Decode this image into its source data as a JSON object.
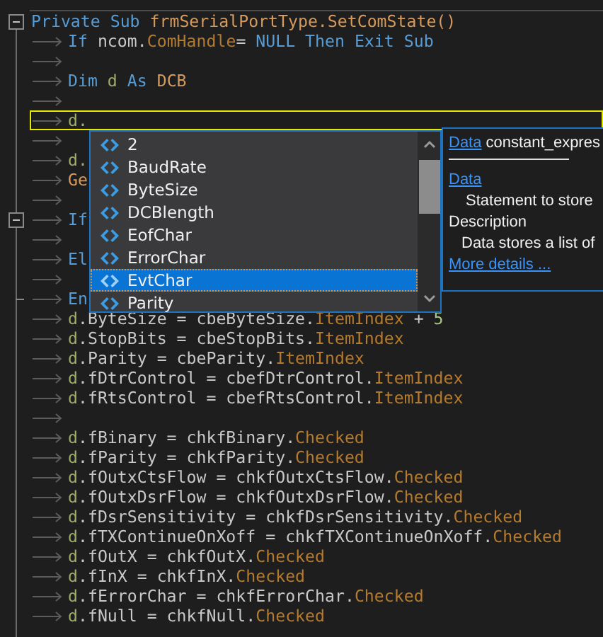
{
  "editor": {
    "lines": [
      {
        "kind": "foldstart",
        "indented": false,
        "current": false,
        "tokens": [
          {
            "text": "Private Sub ",
            "kind": "keyword"
          },
          {
            "text": "frmSerialPortType.SetComState()",
            "kind": "type"
          }
        ]
      },
      {
        "kind": "code",
        "indented": true,
        "current": false,
        "tokens": [
          {
            "text": "If ",
            "kind": "keyword"
          },
          {
            "text": "ncom.",
            "kind": "plain"
          },
          {
            "text": "ComHandle",
            "kind": "member"
          },
          {
            "text": "= ",
            "kind": "plain"
          },
          {
            "text": "NULL Then Exit Sub",
            "kind": "keyword"
          }
        ]
      },
      {
        "kind": "code",
        "indented": true,
        "current": false
      },
      {
        "kind": "code",
        "indented": true,
        "current": false,
        "tokens": [
          {
            "text": "Dim ",
            "kind": "keyword"
          },
          {
            "text": "d ",
            "kind": "variable"
          },
          {
            "text": "As ",
            "kind": "keyword"
          },
          {
            "text": "DCB",
            "kind": "type"
          }
        ]
      },
      {
        "kind": "code",
        "indented": true,
        "current": false
      },
      {
        "kind": "code",
        "indented": true,
        "current": true,
        "tokens": [
          {
            "text": "d.",
            "kind": "variable"
          }
        ]
      },
      {
        "kind": "code",
        "indented": true,
        "current": false
      },
      {
        "kind": "code",
        "indented": true,
        "current": false,
        "tokens": [
          {
            "text": "d.",
            "kind": "variable"
          }
        ]
      },
      {
        "kind": "code",
        "indented": true,
        "current": false,
        "tokens": [
          {
            "text": "Ge",
            "kind": "type"
          }
        ]
      },
      {
        "kind": "code",
        "indented": true,
        "current": false
      },
      {
        "kind": "foldstart",
        "indented": true,
        "current": false,
        "tokens": [
          {
            "text": "If",
            "kind": "keyword"
          }
        ]
      },
      {
        "kind": "code",
        "indented": true,
        "current": false
      },
      {
        "kind": "code",
        "indented": true,
        "current": false,
        "tokens": [
          {
            "text": "El",
            "kind": "keyword"
          }
        ]
      },
      {
        "kind": "code",
        "indented": true,
        "current": false
      },
      {
        "kind": "foldend",
        "indented": true,
        "current": false,
        "tokens": [
          {
            "text": "En",
            "kind": "keyword"
          }
        ]
      },
      {
        "kind": "code",
        "indented": true,
        "current": false,
        "tokens": [
          {
            "text": "d",
            "kind": "variable"
          },
          {
            "text": ".ByteSize = cbeByteSize.",
            "kind": "plain"
          },
          {
            "text": "ItemIndex",
            "kind": "member"
          },
          {
            "text": " + ",
            "kind": "plain"
          },
          {
            "text": "5",
            "kind": "number"
          }
        ]
      },
      {
        "kind": "code",
        "indented": true,
        "current": false,
        "tokens": [
          {
            "text": "d",
            "kind": "variable"
          },
          {
            "text": ".StopBits = cbeStopBits.",
            "kind": "plain"
          },
          {
            "text": "ItemIndex",
            "kind": "member"
          }
        ]
      },
      {
        "kind": "code",
        "indented": true,
        "current": false,
        "tokens": [
          {
            "text": "d",
            "kind": "variable"
          },
          {
            "text": ".Parity = cbeParity.",
            "kind": "plain"
          },
          {
            "text": "ItemIndex",
            "kind": "member"
          }
        ]
      },
      {
        "kind": "code",
        "indented": true,
        "current": false,
        "tokens": [
          {
            "text": "d",
            "kind": "variable"
          },
          {
            "text": ".fDtrControl = cbefDtrControl.",
            "kind": "plain"
          },
          {
            "text": "ItemIndex",
            "kind": "member"
          }
        ]
      },
      {
        "kind": "code",
        "indented": true,
        "current": false,
        "tokens": [
          {
            "text": "d",
            "kind": "variable"
          },
          {
            "text": ".fRtsControl = cbefRtsControl.",
            "kind": "plain"
          },
          {
            "text": "ItemIndex",
            "kind": "member"
          }
        ]
      },
      {
        "kind": "code",
        "indented": true,
        "current": false
      },
      {
        "kind": "code",
        "indented": true,
        "current": false,
        "tokens": [
          {
            "text": "d",
            "kind": "variable"
          },
          {
            "text": ".fBinary = chkfBinary.",
            "kind": "plain"
          },
          {
            "text": "Checked",
            "kind": "member"
          }
        ]
      },
      {
        "kind": "code",
        "indented": true,
        "current": false,
        "tokens": [
          {
            "text": "d",
            "kind": "variable"
          },
          {
            "text": ".fParity = chkfParity.",
            "kind": "plain"
          },
          {
            "text": "Checked",
            "kind": "member"
          }
        ]
      },
      {
        "kind": "code",
        "indented": true,
        "current": false,
        "tokens": [
          {
            "text": "d",
            "kind": "variable"
          },
          {
            "text": ".fOutxCtsFlow = chkfOutxCtsFlow.",
            "kind": "plain"
          },
          {
            "text": "Checked",
            "kind": "member"
          }
        ]
      },
      {
        "kind": "code",
        "indented": true,
        "current": false,
        "tokens": [
          {
            "text": "d",
            "kind": "variable"
          },
          {
            "text": ".fOutxDsrFlow = chkfOutxDsrFlow.",
            "kind": "plain"
          },
          {
            "text": "Checked",
            "kind": "member"
          }
        ]
      },
      {
        "kind": "code",
        "indented": true,
        "current": false,
        "tokens": [
          {
            "text": "d",
            "kind": "variable"
          },
          {
            "text": ".fDsrSensitivity = chkfDsrSensitivity.",
            "kind": "plain"
          },
          {
            "text": "Checked",
            "kind": "member"
          }
        ]
      },
      {
        "kind": "code",
        "indented": true,
        "current": false,
        "tokens": [
          {
            "text": "d",
            "kind": "variable"
          },
          {
            "text": ".fTXContinueOnXoff = chkfTXContinueOnXoff.",
            "kind": "plain"
          },
          {
            "text": "Checked",
            "kind": "member"
          }
        ]
      },
      {
        "kind": "code",
        "indented": true,
        "current": false,
        "tokens": [
          {
            "text": "d",
            "kind": "variable"
          },
          {
            "text": ".fOutX = chkfOutX.",
            "kind": "plain"
          },
          {
            "text": "Checked",
            "kind": "member"
          }
        ]
      },
      {
        "kind": "code",
        "indented": true,
        "current": false,
        "tokens": [
          {
            "text": "d",
            "kind": "variable"
          },
          {
            "text": ".fInX = chkfInX.",
            "kind": "plain"
          },
          {
            "text": "Checked",
            "kind": "member"
          }
        ]
      },
      {
        "kind": "code",
        "indented": true,
        "current": false,
        "tokens": [
          {
            "text": "d",
            "kind": "variable"
          },
          {
            "text": ".fErrorChar = chkfErrorChar.",
            "kind": "plain"
          },
          {
            "text": "Checked",
            "kind": "member"
          }
        ]
      },
      {
        "kind": "code",
        "indented": true,
        "current": false,
        "tokens": [
          {
            "text": "d",
            "kind": "variable"
          },
          {
            "text": ".fNull = chkfNull.",
            "kind": "plain"
          },
          {
            "text": "Checked",
            "kind": "member"
          }
        ]
      }
    ]
  },
  "completion": {
    "items": [
      {
        "label": "2",
        "selected": false
      },
      {
        "label": "BaudRate",
        "selected": false
      },
      {
        "label": "ByteSize",
        "selected": false
      },
      {
        "label": "DCBlength",
        "selected": false
      },
      {
        "label": "EofChar",
        "selected": false
      },
      {
        "label": "ErrorChar",
        "selected": false
      },
      {
        "label": "EvtChar",
        "selected": true
      },
      {
        "label": "Parity",
        "selected": false
      }
    ]
  },
  "tooltip": {
    "signature_link": "Data",
    "signature": "constant_expres",
    "section_link": "Data",
    "section_text": "Statement to store",
    "heading": "Description",
    "description": "Data stores a list of",
    "more_link": "More details ..."
  }
}
